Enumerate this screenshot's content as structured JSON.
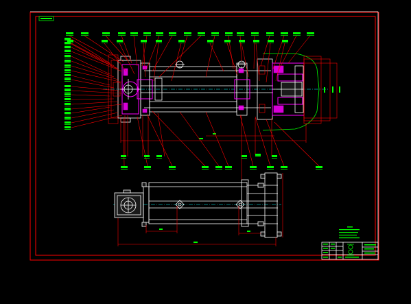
{
  "colors": {
    "background": "#000000",
    "frame": "#ff0000",
    "outline": "#ffffff",
    "label": "#00ff00",
    "accent": "#ff00ff",
    "centerline": "#00ffff",
    "dimension": "#ff0000"
  }
}
